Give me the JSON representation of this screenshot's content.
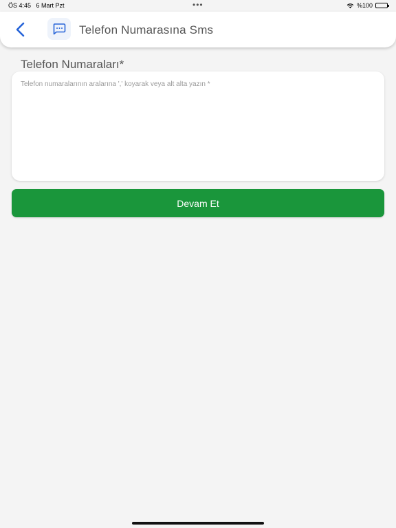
{
  "status_bar": {
    "time": "ÖS 4:45",
    "date": "6 Mart Pzt",
    "dots": "•••",
    "battery": "%100"
  },
  "header": {
    "title": "Telefon Numarasına Sms",
    "back_icon": "chevron-left-icon",
    "title_icon": "message-icon",
    "accent_color": "#2563d8"
  },
  "form": {
    "label": "Telefon Numaraları*",
    "textarea_value": "",
    "textarea_placeholder": "Telefon numaralarının aralarına ',' koyarak veya alt alta yazın *"
  },
  "actions": {
    "continue_label": "Devam Et",
    "continue_color": "#1a963b"
  }
}
